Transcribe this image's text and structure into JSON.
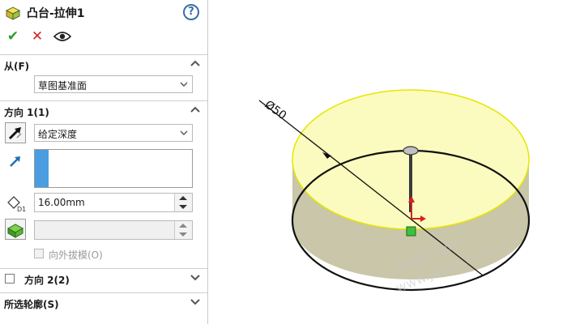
{
  "feature": {
    "title": "凸台-拉伸1",
    "help": "?"
  },
  "actions": {
    "ok": "✔",
    "cancel": "✕",
    "preview": "👁"
  },
  "from": {
    "header": "从(F)",
    "value": "草图基准面"
  },
  "direction1": {
    "header": "方向 1(1)",
    "end_condition": "给定深度",
    "depth_value": "16.00mm",
    "draft_value": "",
    "draft_outward_label": "向外拔模(O)",
    "depth_icon_label": "D1"
  },
  "direction2": {
    "header": "方向 2(2)"
  },
  "selected_contours": {
    "header": "所选轮廓(S)"
  },
  "viewport": {
    "dimension_text": "Ø50",
    "watermark_line1": "机械时代网",
    "watermark_line2": "www.jxage.com"
  },
  "colors": {
    "accent": "#4a9de0",
    "ok_green": "#2a9a2a",
    "cancel_red": "#d32424",
    "top_face": "#fbfbbf",
    "side_face": "#c9c6a9"
  }
}
